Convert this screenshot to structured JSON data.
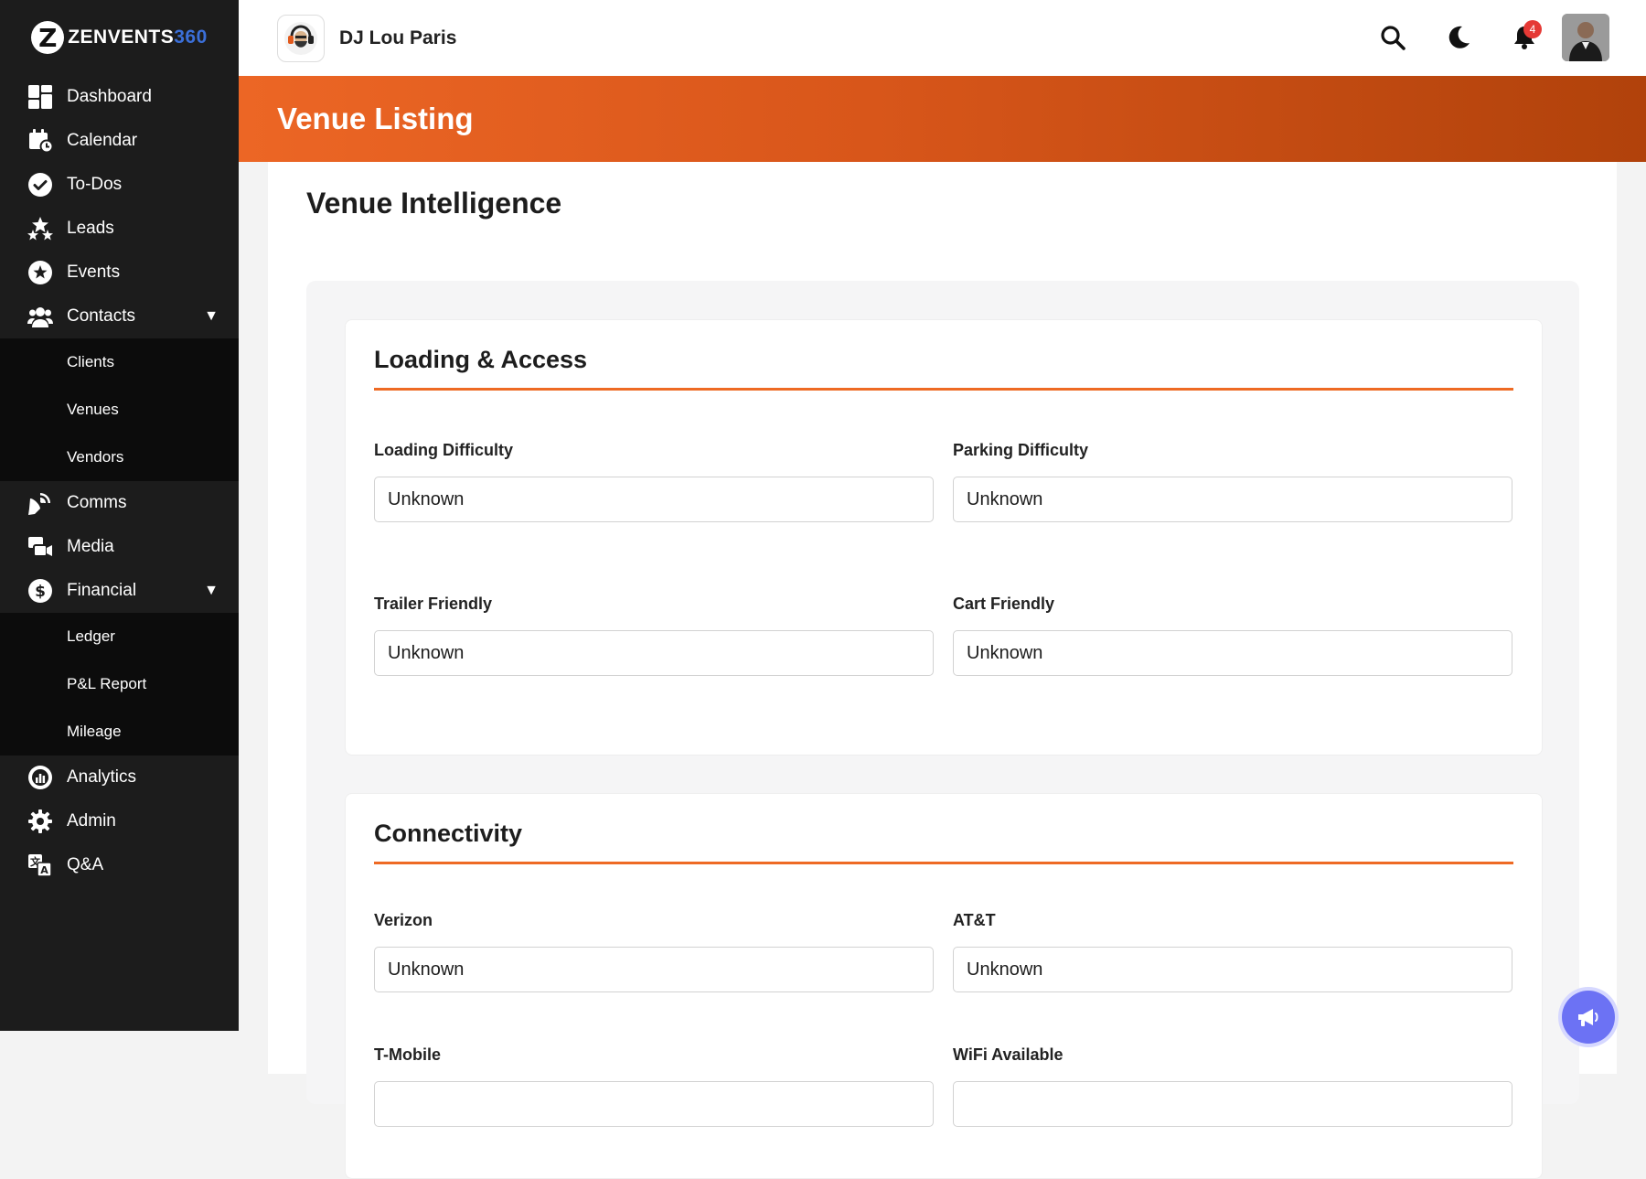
{
  "brand": {
    "logo_letter": "Z",
    "logo_text_main": "ZENVENTS",
    "logo_text_accent": "360"
  },
  "sidebar": {
    "items": [
      {
        "label": "Dashboard",
        "icon": "dashboard-icon"
      },
      {
        "label": "Calendar",
        "icon": "calendar-icon"
      },
      {
        "label": "To-Dos",
        "icon": "check-circle-icon"
      },
      {
        "label": "Leads",
        "icon": "stars-icon"
      },
      {
        "label": "Events",
        "icon": "star-circle-icon"
      },
      {
        "label": "Contacts",
        "icon": "users-icon",
        "expanded": true,
        "children": [
          "Clients",
          "Venues",
          "Vendors"
        ]
      },
      {
        "label": "Comms",
        "icon": "satellite-dish-icon"
      },
      {
        "label": "Media",
        "icon": "photo-video-icon"
      },
      {
        "label": "Financial",
        "icon": "dollar-circle-icon",
        "expanded": true,
        "children": [
          "Ledger",
          "P&L Report",
          "Mileage"
        ]
      },
      {
        "label": "Analytics",
        "icon": "gauge-icon"
      },
      {
        "label": "Admin",
        "icon": "gear-icon"
      },
      {
        "label": "Q&A",
        "icon": "language-icon"
      }
    ],
    "caret": "▼"
  },
  "header": {
    "business_name": "DJ Lou Paris",
    "notification_count": "4"
  },
  "banner": {
    "title": "Venue Listing"
  },
  "main": {
    "title": "Venue Intelligence",
    "sections": [
      {
        "title": "Loading & Access",
        "fields": [
          {
            "label": "Loading Difficulty",
            "value": "Unknown"
          },
          {
            "label": "Parking Difficulty",
            "value": "Unknown"
          },
          {
            "label": "Trailer Friendly",
            "value": "Unknown"
          },
          {
            "label": "Cart Friendly",
            "value": "Unknown"
          }
        ]
      },
      {
        "title": "Connectivity",
        "fields": [
          {
            "label": "Verizon",
            "value": "Unknown"
          },
          {
            "label": "AT&T",
            "value": "Unknown"
          },
          {
            "label": "T-Mobile",
            "value": ""
          },
          {
            "label": "WiFi Available",
            "value": ""
          }
        ]
      }
    ]
  },
  "colors": {
    "accent": "#ec6625",
    "sidebar_bg": "#1c1c1c",
    "fab": "#6c72f4",
    "badge": "#e53935"
  }
}
